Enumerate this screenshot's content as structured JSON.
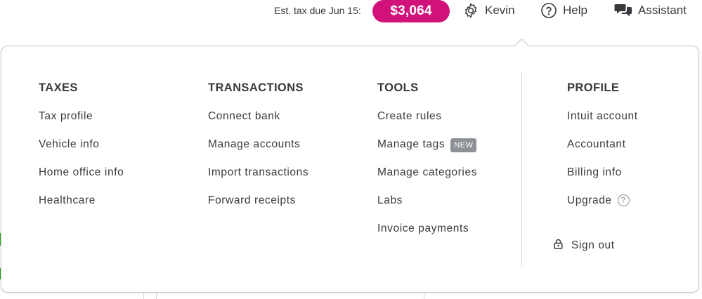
{
  "header": {
    "tax_label": "Est. tax due Jun 15:",
    "tax_amount": "$3,064",
    "user_name": "Kevin",
    "help_label": "Help",
    "assistant_label": "Assistant"
  },
  "colors": {
    "tax_pill": "#d1127b",
    "text": "#393a3d",
    "badge": "#8d9096",
    "border": "#c6c8cc"
  },
  "icons": {
    "user": "gear-icon",
    "help": "question-circle-icon",
    "assistant": "chat-bubbles-icon",
    "signout": "lock-icon"
  },
  "menu": {
    "taxes": {
      "heading": "TAXES",
      "items": [
        "Tax profile",
        "Vehicle info",
        "Home office info",
        "Healthcare"
      ]
    },
    "transactions": {
      "heading": "TRANSACTIONS",
      "items": [
        "Connect bank",
        "Manage accounts",
        "Import transactions",
        "Forward receipts"
      ]
    },
    "tools": {
      "heading": "TOOLS",
      "items": [
        "Create rules",
        "Manage tags",
        "Manage categories",
        "Labs",
        "Invoice payments"
      ],
      "new_badge": "NEW"
    },
    "profile": {
      "heading": "PROFILE",
      "items": [
        "Intuit account",
        "Accountant",
        "Billing info",
        "Upgrade"
      ],
      "help_glyph": "?",
      "sign_out": "Sign out"
    }
  }
}
